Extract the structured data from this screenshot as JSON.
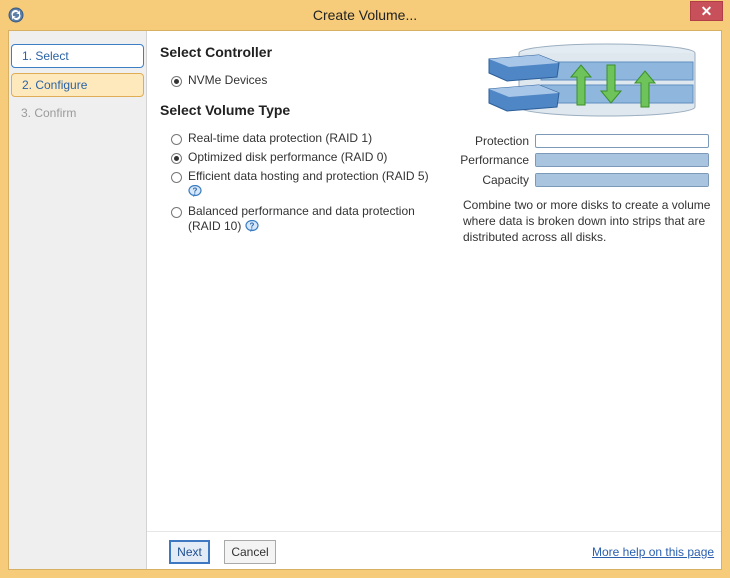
{
  "window": {
    "title": "Create Volume...",
    "close_glyph": "✕"
  },
  "sidebar": {
    "steps": [
      {
        "label": "1. Select",
        "state": "active"
      },
      {
        "label": "2. Configure",
        "state": "highlighted"
      },
      {
        "label": "3. Confirm",
        "state": "disabled"
      }
    ]
  },
  "controller": {
    "heading": "Select Controller",
    "options": [
      {
        "label": "NVMe Devices",
        "selected": true
      }
    ]
  },
  "volume_type": {
    "heading": "Select Volume Type",
    "options": [
      {
        "label": "Real-time data protection (RAID 1)",
        "selected": false
      },
      {
        "label": "Optimized disk performance (RAID 0)",
        "selected": true
      },
      {
        "label": "Efficient data hosting and protection (RAID 5)",
        "selected": false,
        "help_icon": "help-bubble-icon"
      },
      {
        "label_line1": "Balanced performance and data protection",
        "label_line2": "(RAID 10)",
        "selected": false,
        "help_icon": "help-bubble-icon"
      }
    ]
  },
  "meters": [
    {
      "label": "Protection",
      "level": 0
    },
    {
      "label": "Performance",
      "level": 1
    },
    {
      "label": "Capacity",
      "level": 1
    }
  ],
  "description": "Combine two or more disks to create a volume where data is broken down into strips that are distributed across all disks.",
  "buttons": {
    "next": "Next",
    "cancel": "Cancel"
  },
  "help_link": "More help on this page",
  "colors": {
    "accent": "#3c7fc4",
    "frame": "#f6cc7a",
    "meter_fill": "#a9c4df",
    "link": "#2a5fb0"
  }
}
